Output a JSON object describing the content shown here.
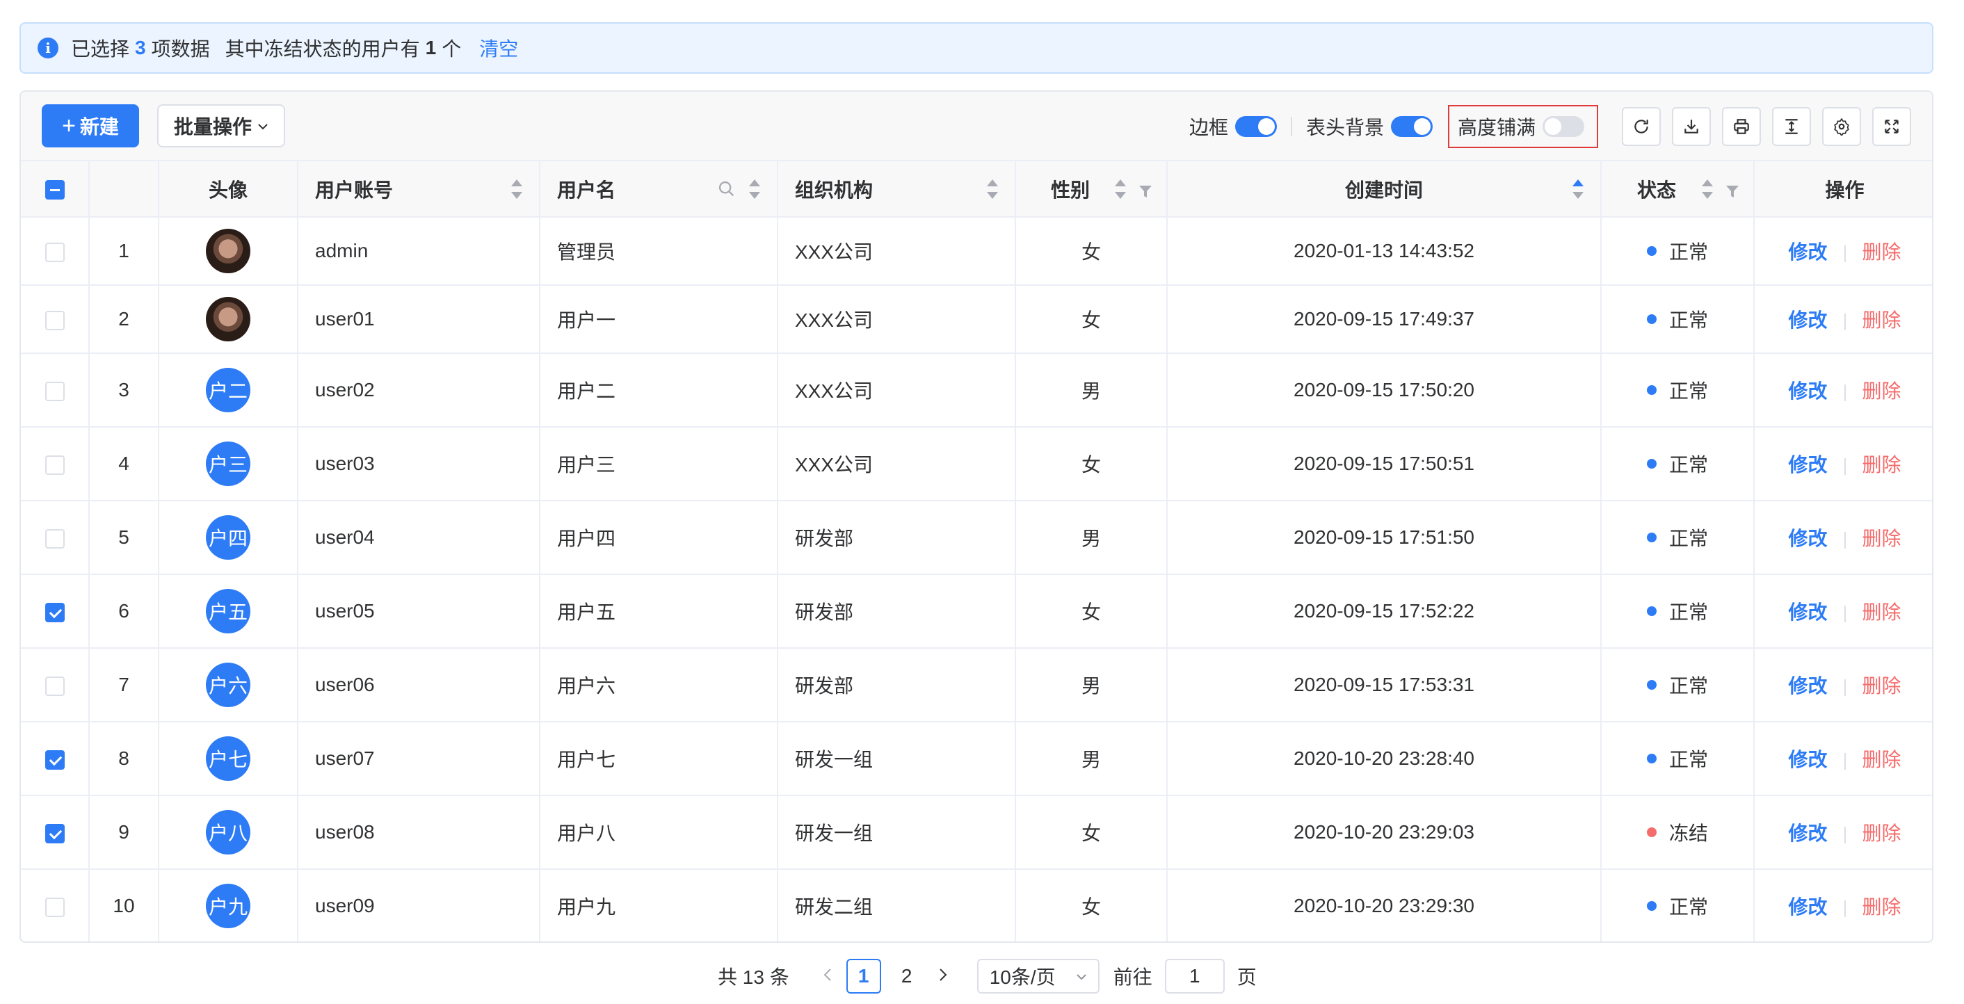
{
  "alert": {
    "prefix": "已选择",
    "count": "3",
    "unit": "项数据",
    "frozen_prefix": "其中冻结状态的用户有",
    "frozen_count": "1",
    "frozen_unit": "个",
    "clear_label": "清空"
  },
  "toolbar": {
    "new_plus": "+",
    "new_label": "新建",
    "batch_label": "批量操作",
    "switches": {
      "border_label": "边框",
      "border_on": true,
      "header_bg_label": "表头背景",
      "header_bg_on": true,
      "height_fill_label": "高度铺满",
      "height_fill_on": false
    },
    "icons": [
      "refresh-icon",
      "download-icon",
      "print-icon",
      "density-icon",
      "settings-icon",
      "fullscreen-icon"
    ]
  },
  "table": {
    "headers": {
      "avatar": "头像",
      "account": "用户账号",
      "name": "用户名",
      "org": "组织机构",
      "gender": "性别",
      "created": "创建时间",
      "status": "状态",
      "actions": "操作"
    },
    "action_edit": "修改",
    "action_delete": "删除",
    "rows": [
      {
        "checked": false,
        "index": "1",
        "avatar_type": "photo",
        "avatar_text": "",
        "account": "admin",
        "name": "管理员",
        "org": "XXX公司",
        "gender": "女",
        "created": "2020-01-13 14:43:52",
        "status": "正常",
        "status_color": "#2d7cf6"
      },
      {
        "checked": false,
        "index": "2",
        "avatar_type": "photo",
        "avatar_text": "",
        "account": "user01",
        "name": "用户一",
        "org": "XXX公司",
        "gender": "女",
        "created": "2020-09-15 17:49:37",
        "status": "正常",
        "status_color": "#2d7cf6"
      },
      {
        "checked": false,
        "index": "3",
        "avatar_type": "text",
        "avatar_text": "户二",
        "account": "user02",
        "name": "用户二",
        "org": "XXX公司",
        "gender": "男",
        "created": "2020-09-15 17:50:20",
        "status": "正常",
        "status_color": "#2d7cf6"
      },
      {
        "checked": false,
        "index": "4",
        "avatar_type": "text",
        "avatar_text": "户三",
        "account": "user03",
        "name": "用户三",
        "org": "XXX公司",
        "gender": "女",
        "created": "2020-09-15 17:50:51",
        "status": "正常",
        "status_color": "#2d7cf6"
      },
      {
        "checked": false,
        "index": "5",
        "avatar_type": "text",
        "avatar_text": "户四",
        "account": "user04",
        "name": "用户四",
        "org": "研发部",
        "gender": "男",
        "created": "2020-09-15 17:51:50",
        "status": "正常",
        "status_color": "#2d7cf6"
      },
      {
        "checked": true,
        "index": "6",
        "avatar_type": "text",
        "avatar_text": "户五",
        "account": "user05",
        "name": "用户五",
        "org": "研发部",
        "gender": "女",
        "created": "2020-09-15 17:52:22",
        "status": "正常",
        "status_color": "#2d7cf6"
      },
      {
        "checked": false,
        "index": "7",
        "avatar_type": "text",
        "avatar_text": "户六",
        "account": "user06",
        "name": "用户六",
        "org": "研发部",
        "gender": "男",
        "created": "2020-09-15 17:53:31",
        "status": "正常",
        "status_color": "#2d7cf6"
      },
      {
        "checked": true,
        "index": "8",
        "avatar_type": "text",
        "avatar_text": "户七",
        "account": "user07",
        "name": "用户七",
        "org": "研发一组",
        "gender": "男",
        "created": "2020-10-20 23:28:40",
        "status": "正常",
        "status_color": "#2d7cf6"
      },
      {
        "checked": true,
        "index": "9",
        "avatar_type": "text",
        "avatar_text": "户八",
        "account": "user08",
        "name": "用户八",
        "org": "研发一组",
        "gender": "女",
        "created": "2020-10-20 23:29:03",
        "status": "冻结",
        "status_color": "#f56c6c"
      },
      {
        "checked": false,
        "index": "10",
        "avatar_type": "text",
        "avatar_text": "户九",
        "account": "user09",
        "name": "用户九",
        "org": "研发二组",
        "gender": "女",
        "created": "2020-10-20 23:29:30",
        "status": "正常",
        "status_color": "#2d7cf6"
      }
    ]
  },
  "pagination": {
    "total_label": "共 13 条",
    "pages": [
      "1",
      "2"
    ],
    "current": "1",
    "page_size_label": "10条/页",
    "goto_label": "前往",
    "goto_value": "1",
    "page_unit": "页"
  },
  "colors": {
    "primary": "#2d7cf6",
    "danger": "#f56c6c",
    "highlight_border": "#e03b3b"
  }
}
